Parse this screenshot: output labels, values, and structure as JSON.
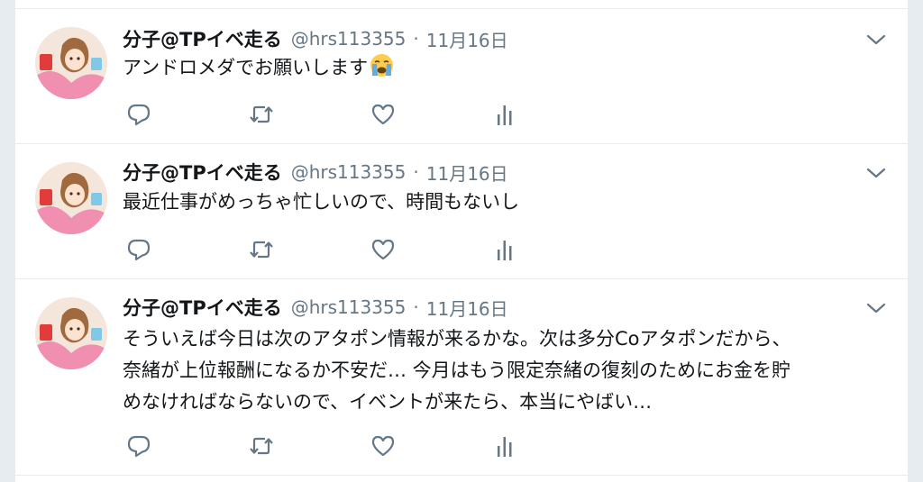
{
  "tweets": [
    {
      "name": "分子@TPイベ走る",
      "handle": "@hrs113355",
      "separator": "·",
      "date": "11月16日",
      "text": "アンドロメダでお願いします",
      "emoji": "loudly-crying-face"
    },
    {
      "name": "分子@TPイベ走る",
      "handle": "@hrs113355",
      "separator": "·",
      "date": "11月16日",
      "text": "最近仕事がめっちゃ忙しいので、時間もないし"
    },
    {
      "name": "分子@TPイベ走る",
      "handle": "@hrs113355",
      "separator": "·",
      "date": "11月16日",
      "text_lines": [
        "そういえば今日は次のアタポン情報が来るかな。次は多分Coアタポンだから、",
        "奈緒が上位報酬になるか不安だ… 今月はもう限定奈緒の復刻のためにお金を貯",
        "めなければならないので、イベントが来たら、本当にやばい…"
      ]
    }
  ],
  "icons": {
    "reply": "reply-icon",
    "retweet": "retweet-icon",
    "like": "heart-icon",
    "analytics": "analytics-icon",
    "more": "chevron-down-icon"
  },
  "colors": {
    "icon_gray": "#657786",
    "text": "#14171a",
    "divider": "#e6ecf0"
  }
}
